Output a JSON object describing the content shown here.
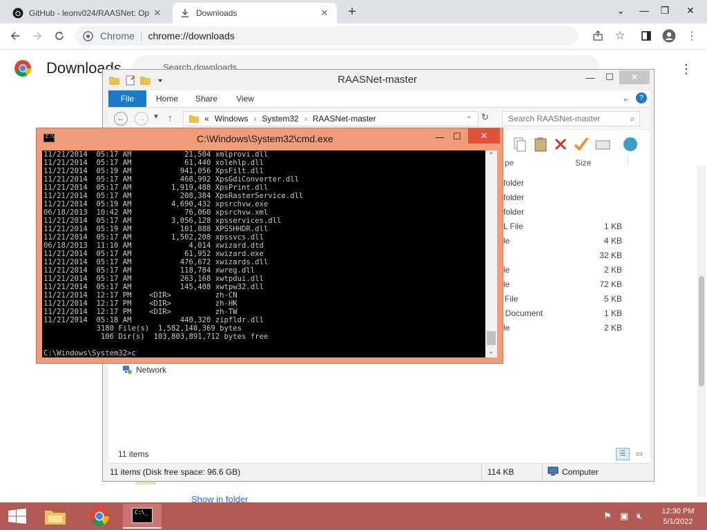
{
  "browser": {
    "tabs": [
      {
        "label": "GitHub - leonv024/RAASNet: Op",
        "close": "✕"
      },
      {
        "label": "Downloads",
        "close": "✕"
      }
    ],
    "new_tab": "+",
    "window_controls": {
      "dropdown": "⌄",
      "minimize": "—",
      "restore": "❐",
      "close": "✕"
    },
    "omnibox": {
      "site": "Chrome",
      "separator": "|",
      "url": "chrome://downloads"
    }
  },
  "downloads_page": {
    "title": "Downloads",
    "search_placeholder": "Search downloads",
    "show_in_folder": "Show in folder"
  },
  "explorer": {
    "title": "RAASNet-master",
    "ribbon_tabs": [
      "File",
      "Home",
      "Share",
      "View"
    ],
    "breadcrumb": [
      "«",
      "Windows",
      "›",
      "System32",
      "›",
      "RAASNet-master"
    ],
    "search_placeholder": "Search RAASNet-master",
    "columns": {
      "type": "pe",
      "size": "Size"
    },
    "rows": [
      {
        "type": "e folder",
        "size": ""
      },
      {
        "type": "e folder",
        "size": ""
      },
      {
        "type": "e folder",
        "size": ""
      },
      {
        "type": "ML File",
        "size": "1 KB"
      },
      {
        "type": "File",
        "size": "4 KB"
      },
      {
        "type": "e",
        "size": "32 KB"
      },
      {
        "type": "File",
        "size": "2 KB"
      },
      {
        "type": "File",
        "size": "72 KB"
      },
      {
        "type": "D File",
        "size": "5 KB"
      },
      {
        "type": "xt Document",
        "size": "1 KB"
      },
      {
        "type": "File",
        "size": "2 KB"
      }
    ],
    "nav_network": "Network",
    "item_count": "11 items",
    "status_left": "11 items (Disk free space: 96.6 GB)",
    "status_mid": "114 KB",
    "status_right": "Computer"
  },
  "cmd": {
    "title": "C:\\Windows\\System32\\cmd.exe",
    "lines": "11/21/2014  05:17 AM            21,504 xmlprovi.dll\n11/21/2014  05:17 AM            61,440 xolehlp.dll\n11/21/2014  05:19 AM           941,056 XpsFilt.dll\n11/21/2014  05:17 AM           468,992 XpsGdiConverter.dll\n11/21/2014  05:17 AM         1,919,488 XpsPrint.dll\n11/21/2014  05:17 AM           208,384 XpsRasterService.dll\n11/21/2014  05:19 AM         4,690,432 xpsrchvw.exe\n06/18/2013  10:42 AM            76,060 xpsrchvw.xml\n11/21/2014  05:17 AM         3,056,128 xpsservices.dll\n11/21/2014  05:19 AM           101,888 XPSSHHDR.dll\n11/21/2014  05:17 AM         1,502,208 xpssvcs.dll\n06/18/2013  11:10 AM             4,014 xwizard.dtd\n11/21/2014  05:17 AM            61,952 xwizard.exe\n11/21/2014  05:17 AM           476,672 xwizards.dll\n11/21/2014  05:17 AM           118,784 xwreg.dll\n11/21/2014  05:17 AM           263,168 xwtpdui.dll\n11/21/2014  05:17 AM           145,408 xwtpw32.dll\n11/21/2014  12:17 PM    <DIR>          zh-CN\n11/21/2014  12:17 PM    <DIR>          zh-HK\n11/21/2014  12:17 PM    <DIR>          zh-TW\n11/21/2014  05:18 AM           440,320 zipfldr.dll\n            3180 File(s)  1,582,140,369 bytes\n             106 Dir(s)  103,803,891,712 bytes free",
    "prompt": "C:\\Windows\\System32>c"
  },
  "taskbar": {
    "time": "12:30 PM",
    "date": "5/1/2022"
  },
  "colors": {
    "cmd_frame": "#f09c78",
    "cmd_close": "#e0503a",
    "taskbar": "#b45a55",
    "ribbon_file": "#1979ca"
  }
}
